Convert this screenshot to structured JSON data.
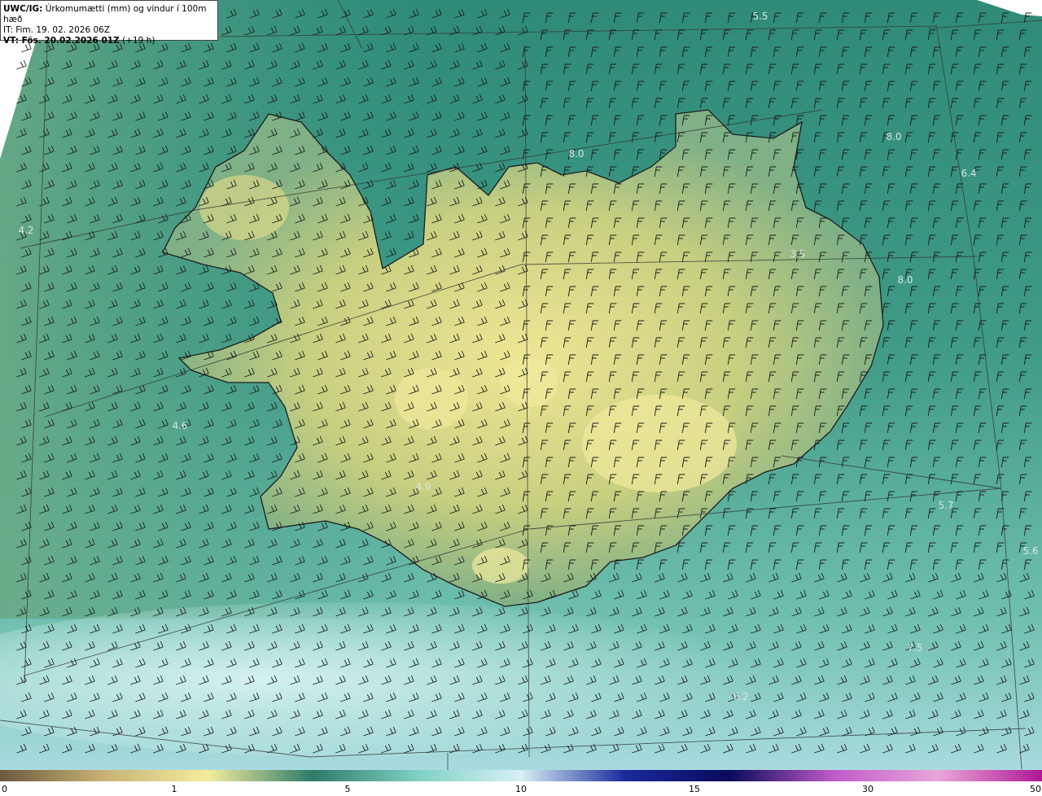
{
  "info": {
    "line1_bold": "UWC/IG:",
    "line1_rest": " Úrkomumætti (mm) og vindur í 100m hæð",
    "line2": "IT: Fim. 19. 02. 2026 06Z",
    "line3_bold": "VT: Fös. 20.02.2026 01Z",
    "line3_rest": " (+19 h)"
  },
  "value_labels": [
    {
      "id": "v1",
      "text": "5.5"
    },
    {
      "id": "v2",
      "text": "4.2"
    },
    {
      "id": "v3",
      "text": "8.0"
    },
    {
      "id": "v4",
      "text": "6.4"
    },
    {
      "id": "v5",
      "text": "8.0"
    },
    {
      "id": "v6",
      "text": "3.5"
    },
    {
      "id": "v7",
      "text": "8.0"
    },
    {
      "id": "v8",
      "text": "4.6"
    },
    {
      "id": "v9",
      "text": "4.9"
    },
    {
      "id": "v10",
      "text": "5.7"
    },
    {
      "id": "v11",
      "text": "5.6"
    },
    {
      "id": "v12",
      "text": "7.5"
    },
    {
      "id": "v13",
      "text": "6.2"
    }
  ],
  "colorbar": {
    "ticks": [
      "0",
      "1",
      "5",
      "10",
      "15",
      "30",
      "50"
    ],
    "stops": [
      "#6b5a3e",
      "#c9b275",
      "#f3ed9c",
      "#2e7a6a",
      "#7fd0c4",
      "#d8f0f5",
      "#1a2a9c",
      "#0a0a5a",
      "#c05ac9",
      "#e9a6d9",
      "#b01896"
    ]
  },
  "colors": {
    "land_light": "#e9e08a",
    "sea_mid": "#3f9a86",
    "sea_light": "#b7e6e4",
    "coast": "#1c1c1c"
  }
}
